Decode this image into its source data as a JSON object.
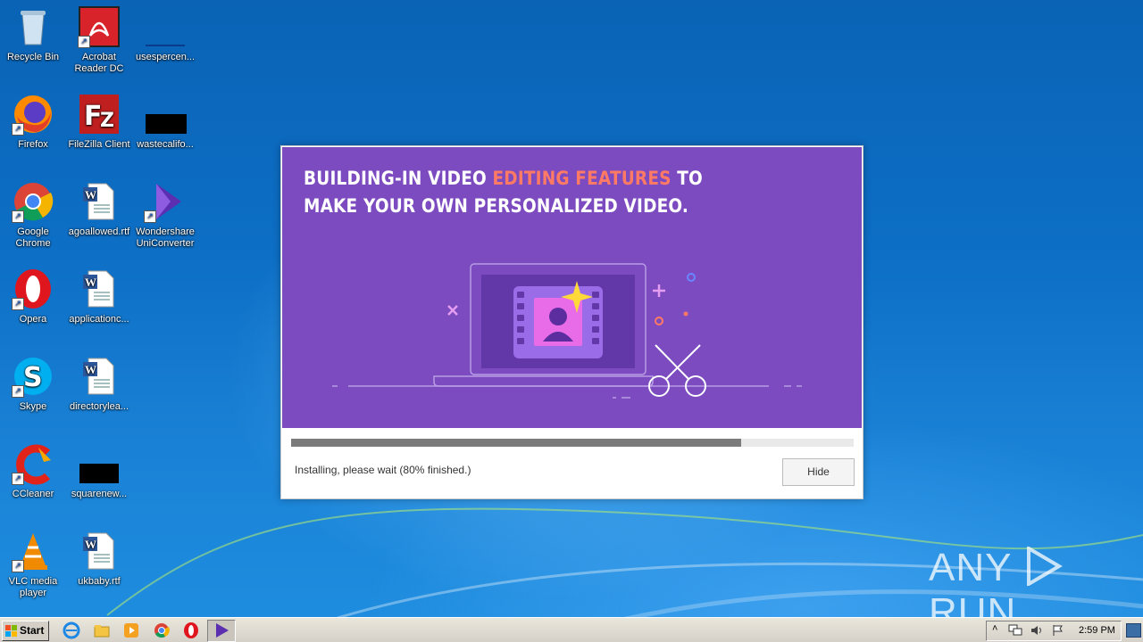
{
  "desktop": {
    "icons": [
      {
        "label": "Recycle Bin"
      },
      {
        "label": "Acrobat Reader DC"
      },
      {
        "label": "usespercen..."
      },
      {
        "label": "Firefox"
      },
      {
        "label": "FileZilla Client"
      },
      {
        "label": "wastecalifo..."
      },
      {
        "label": "Google Chrome"
      },
      {
        "label": "agoallowed.rtf"
      },
      {
        "label": "Wondershare UniConverter"
      },
      {
        "label": "Opera"
      },
      {
        "label": "applicationc..."
      },
      {
        "label": "Skype"
      },
      {
        "label": "directorylea..."
      },
      {
        "label": "CCleaner"
      },
      {
        "label": "squarenew..."
      },
      {
        "label": "VLC media player"
      },
      {
        "label": "ukbaby.rtf"
      }
    ]
  },
  "installer": {
    "headline_line1_part1": "BUILDING-IN VIDEO ",
    "headline_line1_highlight": "EDITING FEATURES",
    "headline_line1_part2": " TO",
    "headline_line2": "MAKE YOUR OWN PERSONALIZED VIDEO.",
    "progress_percent": 80,
    "status_text": "Installing, please wait (80% finished.)",
    "hide_label": "Hide",
    "colors": {
      "banner": "#7c4bc0",
      "highlight": "#ff7a64",
      "progress": "#7b7b7b"
    }
  },
  "taskbar": {
    "start_label": "Start",
    "clock": "2:59 PM",
    "pinned_icons": [
      "internet-explorer-icon",
      "explorer-icon",
      "media-player-icon",
      "chrome-icon",
      "opera-icon",
      "uniconverter-icon"
    ]
  },
  "watermark": {
    "text_left": "ANY",
    "text_right": "RUN"
  }
}
